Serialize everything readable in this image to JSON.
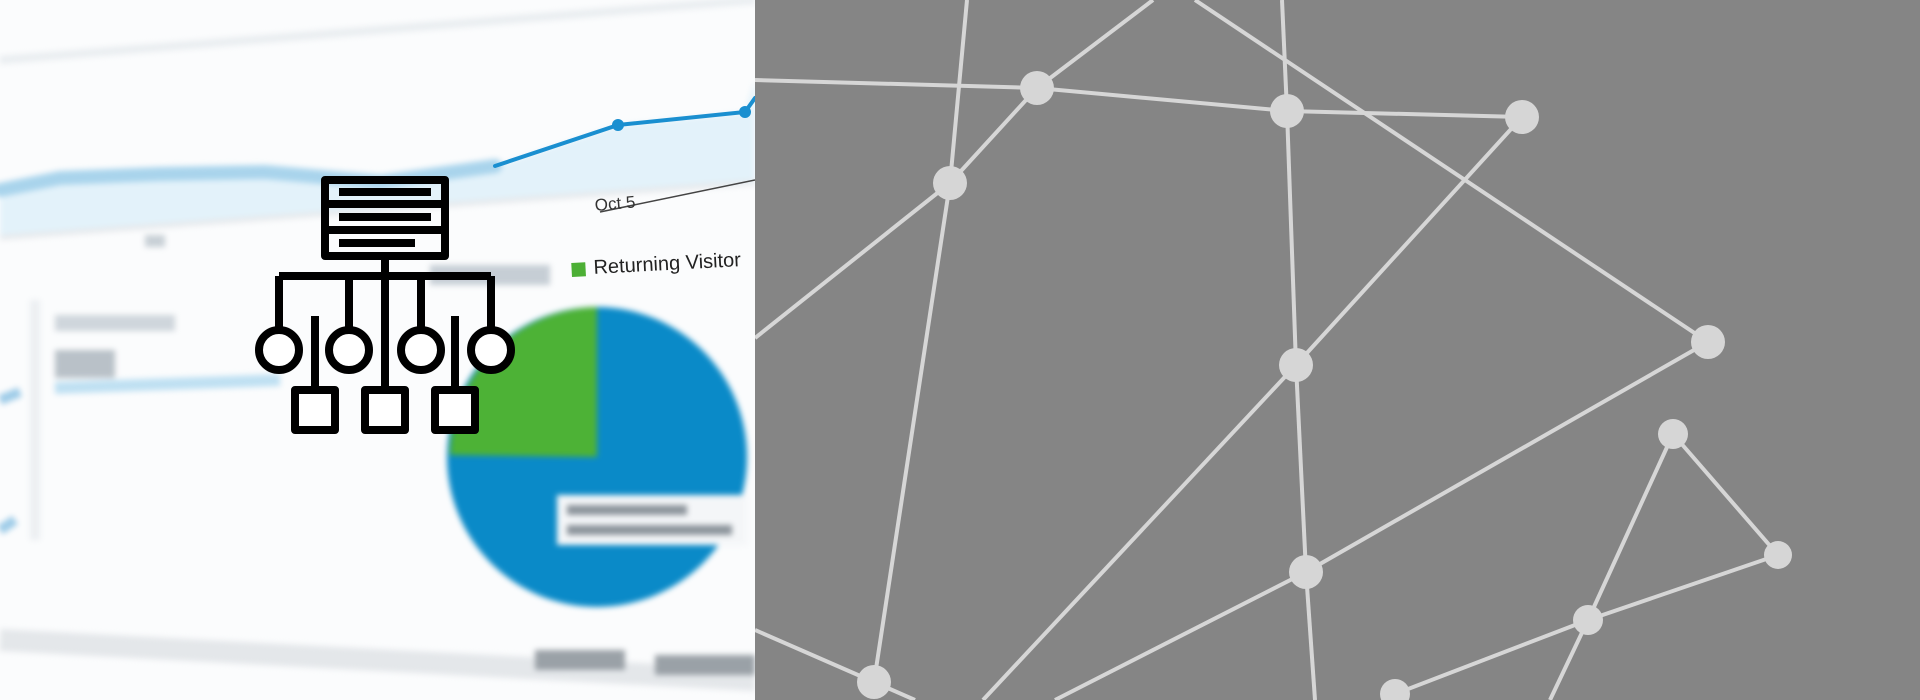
{
  "analytics_background": {
    "axis_date_label": "Oct 5",
    "legend_label": "Returning Visitor",
    "colors": {
      "line": "#1a8fd0",
      "area": "#e3f2fa",
      "pie_blue": "#0a8ac8",
      "pie_green": "#4db236",
      "legend_green": "#4caf35"
    }
  },
  "hierarchy_icon": {
    "icon": "server-network-hierarchy-icon",
    "color": "#000000"
  },
  "network_panel": {
    "background": "#858585",
    "node_color": "#d6d6d6",
    "edge_color": "#d6d6d6"
  }
}
